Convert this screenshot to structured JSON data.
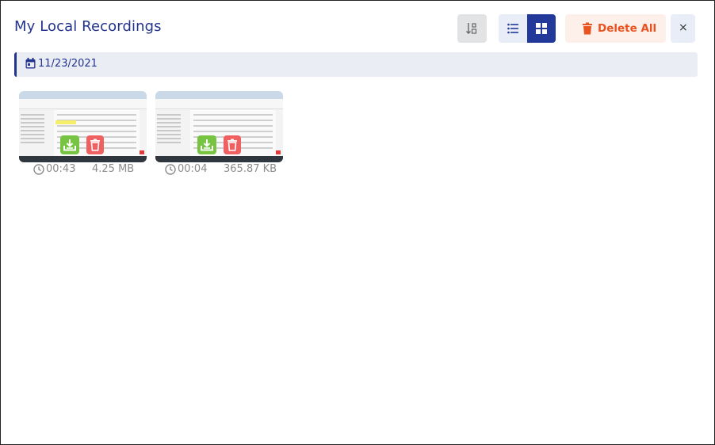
{
  "header": {
    "title": "My Local Recordings",
    "delete_all_label": "Delete All",
    "close_label": "×"
  },
  "group": {
    "date": "11/23/2021"
  },
  "recordings": [
    {
      "duration": "00:43",
      "size": "4.25 MB",
      "thumb_highlight": "Managing Data Alerts"
    },
    {
      "duration": "00:04",
      "size": "365.87 KB",
      "thumb_highlight": ""
    }
  ],
  "colors": {
    "primary": "#23348f",
    "danger_text": "#e8531f",
    "download_green": "#76c442",
    "delete_red": "#f06060"
  },
  "icons": [
    "sort-icon",
    "list-view-icon",
    "grid-view-icon",
    "trash-icon",
    "close-icon",
    "calendar-icon",
    "download-icon",
    "clock-icon"
  ]
}
